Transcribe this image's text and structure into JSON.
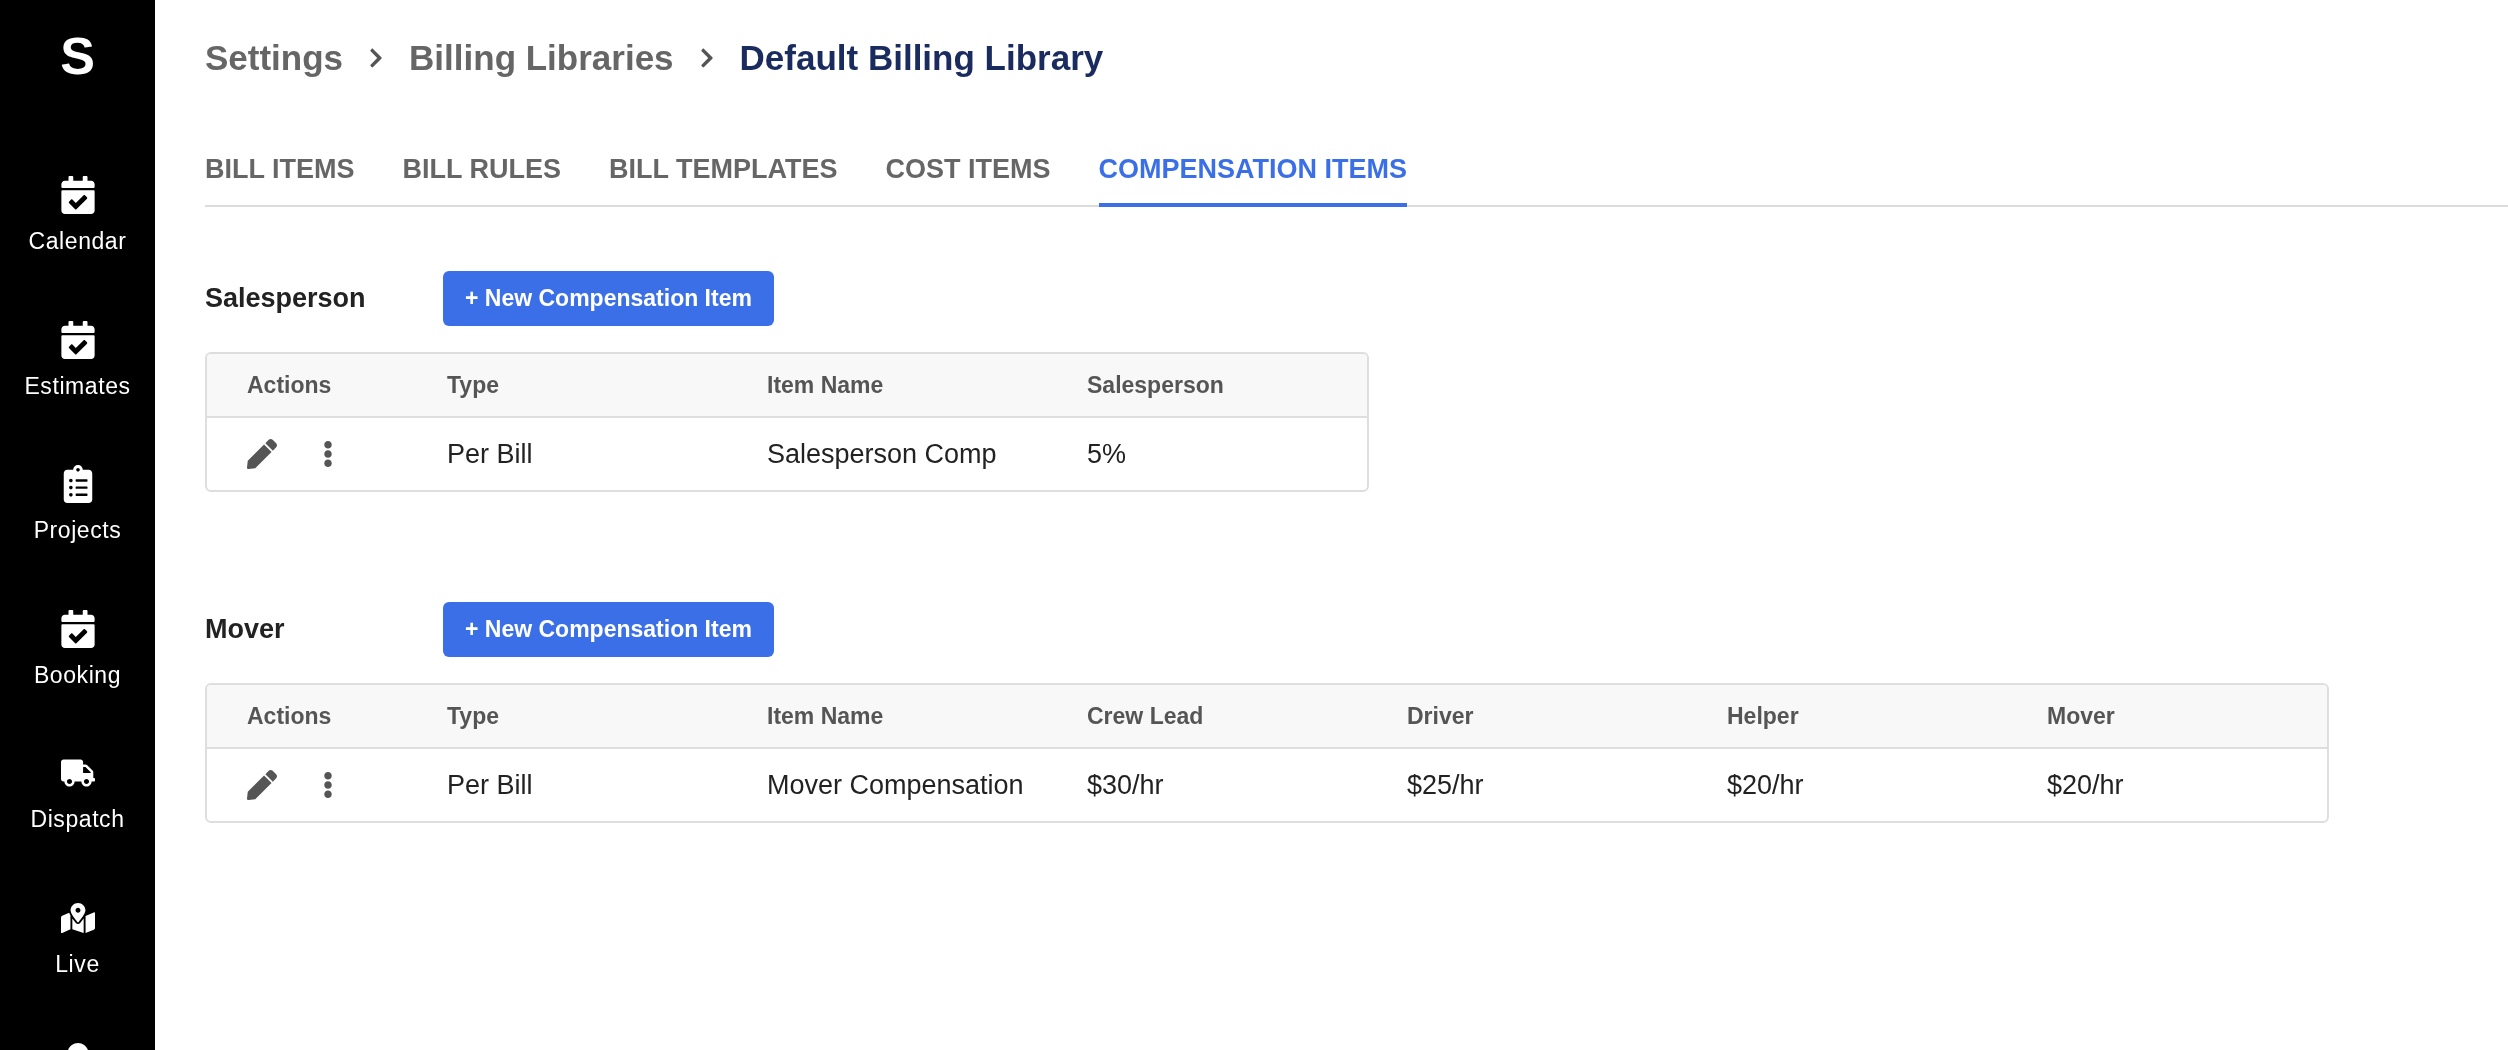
{
  "sidebar": {
    "logo": "S",
    "items": [
      {
        "label": "Calendar"
      },
      {
        "label": "Estimates"
      },
      {
        "label": "Projects"
      },
      {
        "label": "Booking"
      },
      {
        "label": "Dispatch"
      },
      {
        "label": "Live"
      }
    ]
  },
  "breadcrumb": [
    "Settings",
    "Billing Libraries",
    "Default Billing Library"
  ],
  "tabs": [
    {
      "label": "BILL ITEMS",
      "selected": false
    },
    {
      "label": "BILL RULES",
      "selected": false
    },
    {
      "label": "BILL TEMPLATES",
      "selected": false
    },
    {
      "label": "COST ITEMS",
      "selected": false
    },
    {
      "label": "COMPENSATION ITEMS",
      "selected": true
    }
  ],
  "sections": [
    {
      "title": "Salesperson",
      "button": "+ New Compensation Item",
      "columns": [
        "Actions",
        "Type",
        "Item Name",
        "Salesperson"
      ],
      "rows": [
        [
          "",
          "Per Bill",
          "Salesperson Comp",
          "5%"
        ]
      ]
    },
    {
      "title": "Mover",
      "button": "+ New Compensation Item",
      "columns": [
        "Actions",
        "Type",
        "Item Name",
        "Crew Lead",
        "Driver",
        "Helper",
        "Mover"
      ],
      "rows": [
        [
          "",
          "Per Bill",
          "Mover Compensation",
          "$30/hr",
          "$25/hr",
          "$20/hr",
          "$20/hr"
        ]
      ]
    }
  ]
}
